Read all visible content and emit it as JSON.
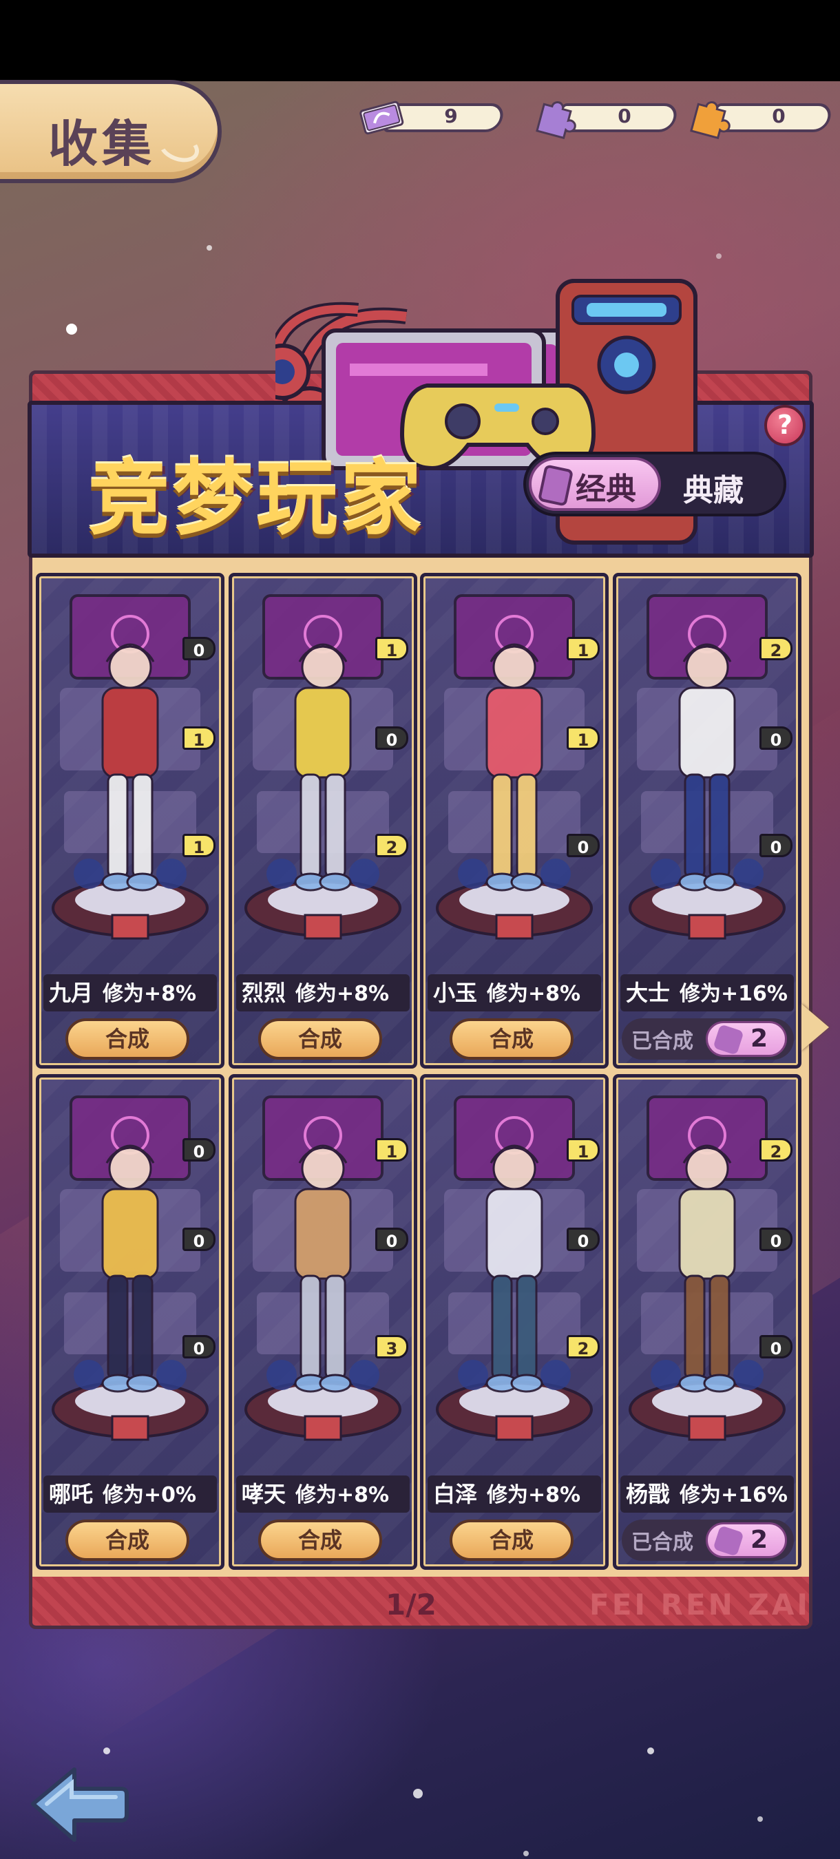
{
  "header": {
    "title": "收集"
  },
  "currencies": [
    {
      "icon": "ticket-icon",
      "value": "9",
      "color": "#b98be0"
    },
    {
      "icon": "purple-puzzle-icon",
      "value": "0",
      "color": "#a67fd4"
    },
    {
      "icon": "orange-puzzle-icon",
      "value": "0",
      "color": "#f0a03a"
    }
  ],
  "banner": {
    "title": "竞梦玩家",
    "toggle": {
      "active": "经典",
      "inactive": "典藏"
    },
    "help": "?"
  },
  "characters": [
    {
      "name": "九月",
      "bonus": "修为+8%",
      "pieces": [
        "0",
        "1",
        "1"
      ],
      "status": "合成"
    },
    {
      "name": "烈烈",
      "bonus": "修为+8%",
      "pieces": [
        "1",
        "0",
        "2"
      ],
      "status": "合成"
    },
    {
      "name": "小玉",
      "bonus": "修为+8%",
      "pieces": [
        "1",
        "1",
        "0"
      ],
      "status": "合成"
    },
    {
      "name": "大士",
      "bonus": "修为+16%",
      "pieces": [
        "2",
        "0",
        "0"
      ],
      "status": "已合成",
      "count": "2"
    },
    {
      "name": "哪吒",
      "bonus": "修为+0%",
      "pieces": [
        "0",
        "0",
        "0"
      ],
      "status": "合成"
    },
    {
      "name": "哮天",
      "bonus": "修为+8%",
      "pieces": [
        "1",
        "0",
        "3"
      ],
      "status": "合成"
    },
    {
      "name": "白泽",
      "bonus": "修为+8%",
      "pieces": [
        "1",
        "0",
        "2"
      ],
      "status": "合成"
    },
    {
      "name": "杨戬",
      "bonus": "修为+16%",
      "pieces": [
        "2",
        "0",
        "0"
      ],
      "status": "已合成",
      "count": "2"
    }
  ],
  "pagination": {
    "label": "1/2"
  },
  "watermark": "FEI REN ZAI",
  "colors": {
    "accent_gold": "#ffd45e",
    "panel_purple": "#3b3765",
    "button_orange": "#e9a85a",
    "pill_pink": "#e79fdf"
  }
}
